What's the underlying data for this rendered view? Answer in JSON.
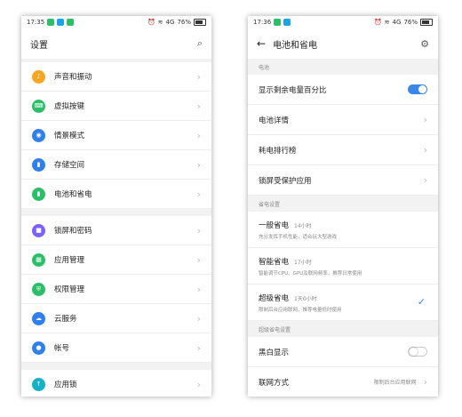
{
  "left": {
    "status": {
      "time": "17:35",
      "battery": "76%",
      "network": "4G"
    },
    "title": "设置",
    "groups": [
      [
        {
          "label": "声音和振动",
          "icon": "bell-icon",
          "color": "#f5a623",
          "glyph": "♪"
        },
        {
          "label": "虚拟按键",
          "icon": "keyboard-icon",
          "color": "#2bbf6a",
          "glyph": "⌨"
        },
        {
          "label": "情景模式",
          "icon": "eye-icon",
          "color": "#2f80ed",
          "glyph": "◉"
        },
        {
          "label": "存储空间",
          "icon": "sd-card-icon",
          "color": "#2f80ed",
          "glyph": "▮"
        },
        {
          "label": "电池和省电",
          "icon": "battery-icon",
          "color": "#2bbf6a",
          "glyph": "▮"
        }
      ],
      [
        {
          "label": "锁屏和密码",
          "icon": "lock-icon",
          "color": "#7b61ff",
          "glyph": "🔒"
        },
        {
          "label": "应用管理",
          "icon": "apps-icon",
          "color": "#2bbf6a",
          "glyph": "▦"
        },
        {
          "label": "权限管理",
          "icon": "shield-icon",
          "color": "#2bbf6a",
          "glyph": "⛨"
        },
        {
          "label": "云服务",
          "icon": "cloud-icon",
          "color": "#2f80ed",
          "glyph": "☁"
        },
        {
          "label": "帐号",
          "icon": "account-icon",
          "color": "#2f80ed",
          "glyph": "●"
        }
      ],
      [
        {
          "label": "应用锁",
          "icon": "app-lock-icon",
          "color": "#16b1c9",
          "glyph": "↑"
        }
      ]
    ]
  },
  "right": {
    "status": {
      "time": "17:36",
      "battery": "76%",
      "network": "4G"
    },
    "title": "电池和省电",
    "section_battery": "电池",
    "show_percent": {
      "label": "显示剩余电量百分比",
      "on": true
    },
    "battery_details": "电池详情",
    "power_ranking": "耗电排行榜",
    "lockscreen_apps": "锁屏受保护应用",
    "section_saving": "省电设置",
    "modes": [
      {
        "name": "一般省电",
        "time": "14小时",
        "desc": "充分发挥手机性能，适合玩大型游戏",
        "checked": false
      },
      {
        "name": "智能省电",
        "time": "17小时",
        "desc": "智能调节CPU、GPU及联网频率，推荐日常使用",
        "checked": false
      },
      {
        "name": "超级省电",
        "time": "1天0小时",
        "desc": "限制后台应用联网，推荐电量低时使用",
        "checked": true
      }
    ],
    "section_super": "超级省电设置",
    "mono_display": {
      "label": "黑白显示",
      "on": false
    },
    "network_mode": {
      "label": "联网方式",
      "value": "限制后台应用联网"
    }
  }
}
